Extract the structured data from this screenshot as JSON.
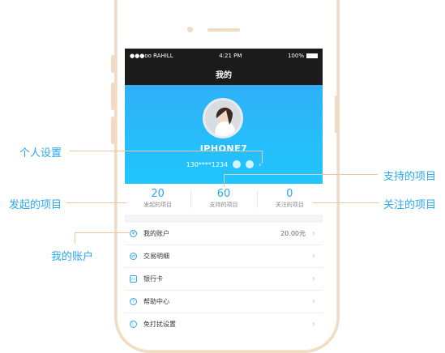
{
  "status_bar": {
    "carrier": "●●●oo RAHILL",
    "time": "4:21 PM",
    "battery": "100%"
  },
  "nav": {
    "title": "我的"
  },
  "profile": {
    "username": "IPHONE7",
    "phone": "130****1234"
  },
  "stats": [
    {
      "value": "20",
      "label": "发起的项目"
    },
    {
      "value": "60",
      "label": "支持的项目"
    },
    {
      "value": "0",
      "label": "关注的项目"
    }
  ],
  "menu": [
    {
      "label": "我的账户",
      "value": "20.00元",
      "icon": "wallet-icon"
    },
    {
      "label": "交易明细",
      "value": "",
      "icon": "transaction-icon"
    },
    {
      "label": "银行卡",
      "value": "",
      "icon": "card-icon"
    },
    {
      "label": "帮助中心",
      "value": "",
      "icon": "help-icon"
    },
    {
      "label": "免打扰设置",
      "value": "",
      "icon": "dnd-icon"
    }
  ],
  "annotations": {
    "personal_settings": "个人设置",
    "supported": "支持的项目",
    "initiated": "发起的项目",
    "followed": "关注的项目",
    "my_account": "我的账户"
  },
  "colors": {
    "accent": "#2aa8f0",
    "phone_frame": "#f0dcc3",
    "guide_line": "#e9c8a2"
  }
}
